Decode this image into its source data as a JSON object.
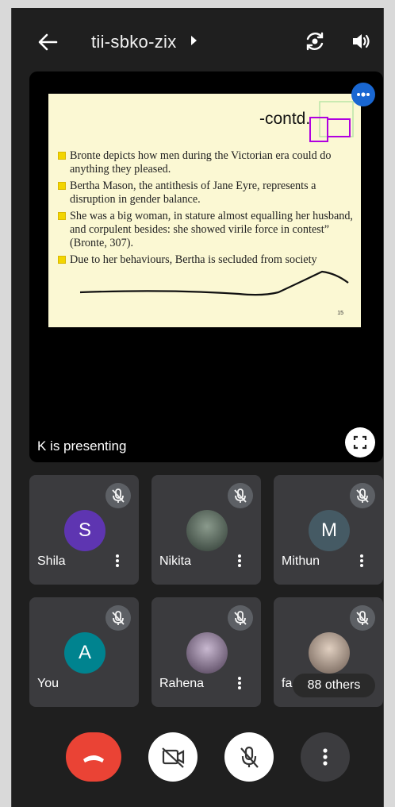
{
  "header": {
    "meeting_code": "tii-sbko-zix",
    "back_icon": "arrow-left-icon",
    "camera_switch_icon": "camera-switch-icon",
    "speaker_icon": "speaker-icon"
  },
  "presentation": {
    "slide": {
      "title": "-contd.",
      "bullets": [
        "Bronte depicts how men during the Victorian era could do anything they pleased.",
        "Bertha Mason, the antithesis of Jane Eyre, represents a disruption in gender balance.",
        "She was a big woman, in stature almost equalling her husband, and corpulent besides: she showed virile force in contest” (Bronte, 307).",
        "Due to her behaviours, Bertha is secluded from society"
      ],
      "page_number": "15"
    },
    "presenting_label": "K is presenting"
  },
  "participants": [
    {
      "name": "Shila",
      "initial": "S",
      "avatar_color": "#5e35b1"
    },
    {
      "name": "Nikita",
      "initial": "",
      "avatar_color": "#4a5a4f"
    },
    {
      "name": "Mithun",
      "initial": "M",
      "avatar_color": "#455a64"
    },
    {
      "name": "You",
      "initial": "A",
      "avatar_color": "#00838f"
    },
    {
      "name": "Rahena",
      "initial": "",
      "avatar_color": "#7a6a8a"
    },
    {
      "name": "fa",
      "initial": "",
      "avatar_color": "#b8a89a"
    }
  ],
  "others_label": "88 others",
  "controls": {
    "end_call_color": "#ea4335"
  }
}
